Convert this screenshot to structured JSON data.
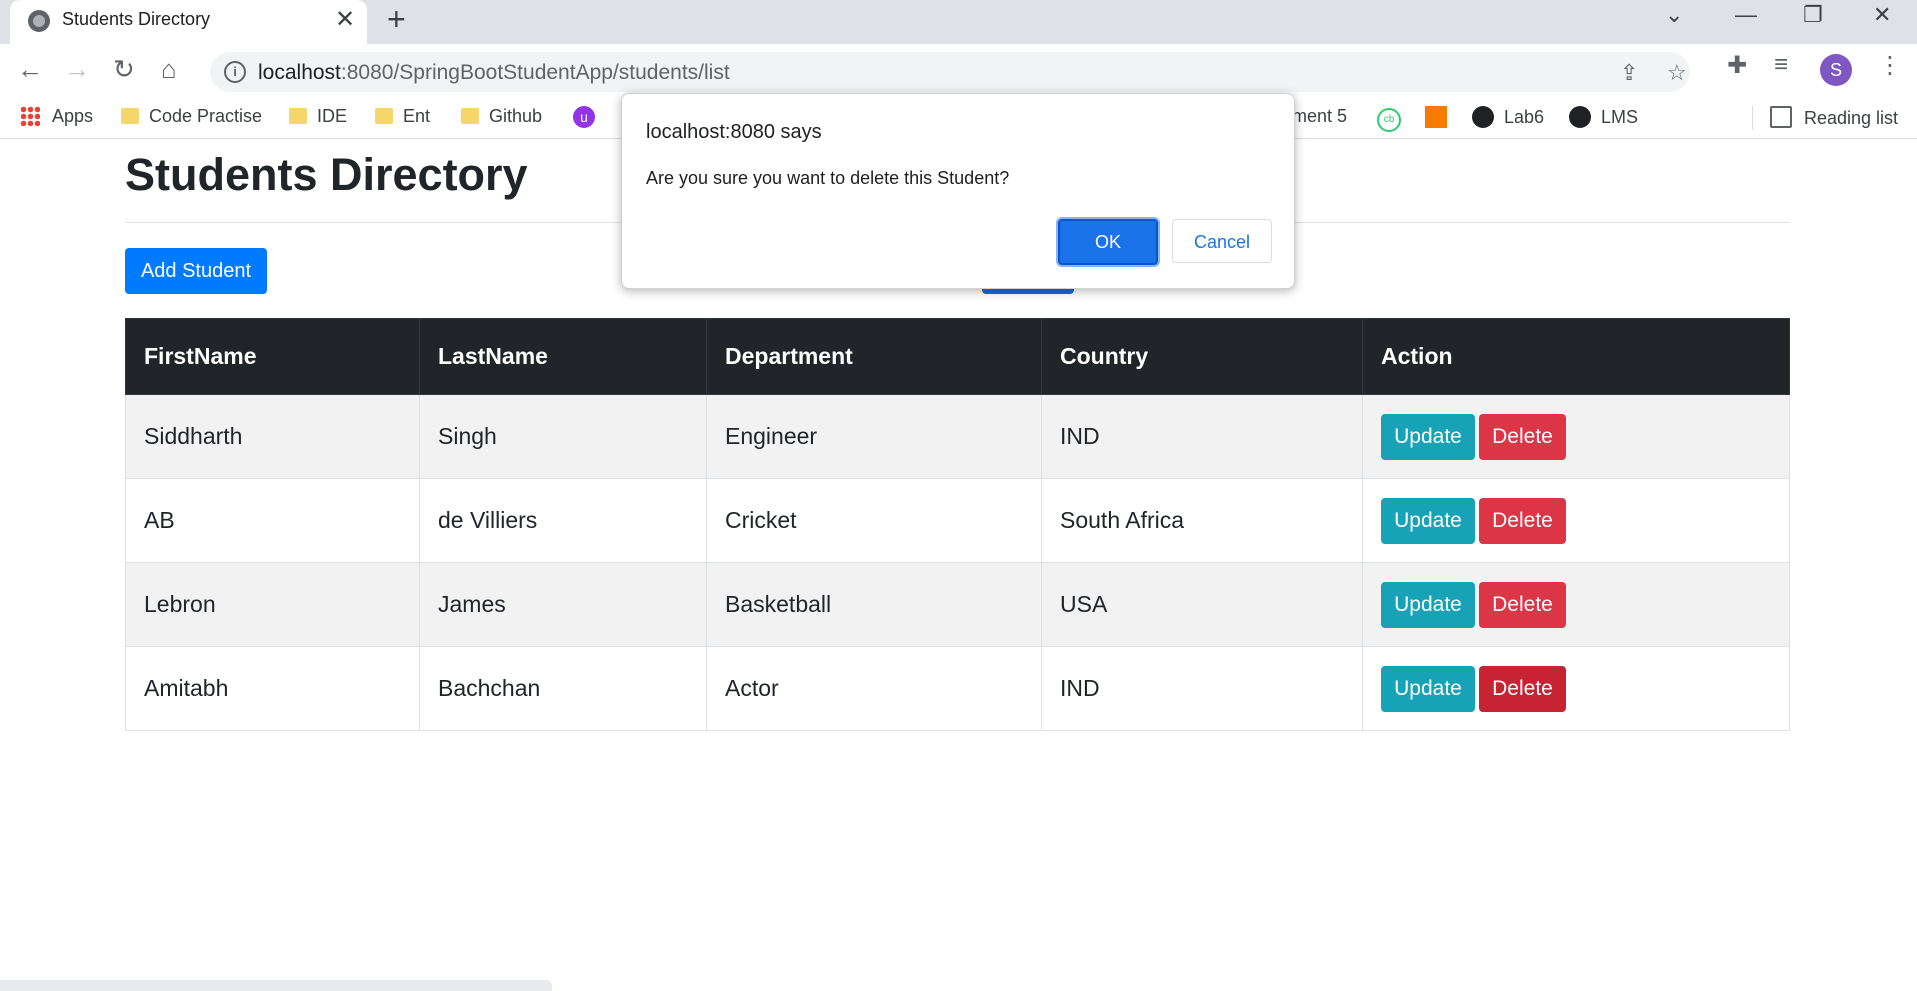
{
  "browser": {
    "tab_title": "Students Directory",
    "url_host": "localhost",
    "url_rest": ":8080/SpringBootStudentApp/students/list",
    "profile_initial": "S"
  },
  "bookmarks": [
    {
      "label": "Apps",
      "icon": "apps-grid-icon"
    },
    {
      "label": "Code Practise",
      "icon": "folder-icon"
    },
    {
      "label": "IDE",
      "icon": "folder-icon"
    },
    {
      "label": "Ent",
      "icon": "folder-icon"
    },
    {
      "label": "Github",
      "icon": "folder-icon"
    },
    {
      "label": "ment 5",
      "icon": ""
    },
    {
      "label": "Lab6",
      "icon": "github-icon"
    },
    {
      "label": "LMS",
      "icon": "github-icon"
    },
    {
      "label": "Reading list",
      "icon": "reading-list-icon"
    }
  ],
  "page": {
    "title": "Students Directory",
    "add_button": "Add Student"
  },
  "table": {
    "headers": [
      "FirstName",
      "LastName",
      "Department",
      "Country",
      "Action"
    ],
    "rows": [
      {
        "first": "Siddharth",
        "last": "Singh",
        "dept": "Engineer",
        "country": "IND"
      },
      {
        "first": "AB",
        "last": "de Villiers",
        "dept": "Cricket",
        "country": "South Africa"
      },
      {
        "first": "Lebron",
        "last": "James",
        "dept": "Basketball",
        "country": "USA"
      },
      {
        "first": "Amitabh",
        "last": "Bachchan",
        "dept": "Actor",
        "country": "IND"
      }
    ],
    "update_label": "Update",
    "delete_label": "Delete"
  },
  "dialog": {
    "title": "localhost:8080 says",
    "message": "Are you sure you want to delete this Student?",
    "ok": "OK",
    "cancel": "Cancel"
  },
  "colors": {
    "primary": "#007bff",
    "info": "#17a2b8",
    "danger": "#dc3545",
    "dark": "#212529"
  }
}
